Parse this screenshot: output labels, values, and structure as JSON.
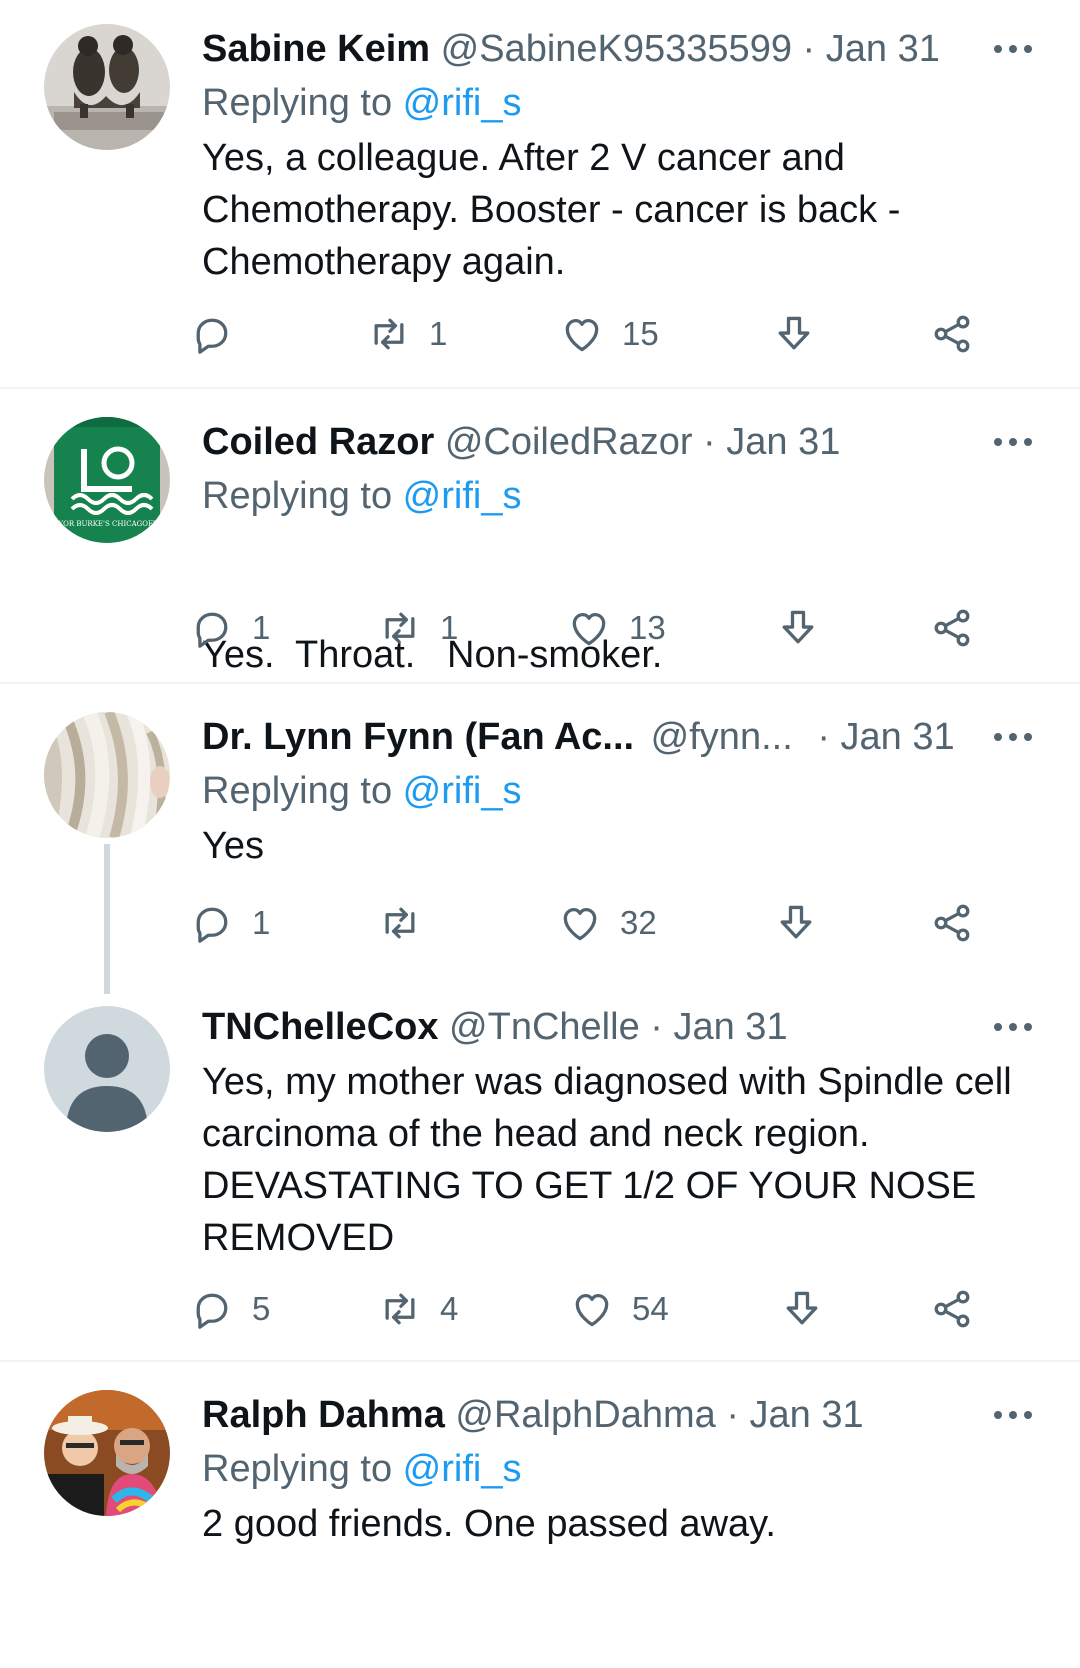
{
  "tweets": [
    {
      "name": "Sabine Keim",
      "handle": "@SabineK95335599",
      "date": "Jan 31",
      "replying_prefix": "Replying to ",
      "replying_to": "@rifi_s",
      "body": [
        "Yes, a colleague. After 2 V cancer and",
        "Chemotherapy. Booster - cancer is back -",
        "Chemotherapy again."
      ],
      "reply_count": "",
      "retweet_count": "1",
      "like_count": "15",
      "avatar_icon": "bronze-statue-avatar"
    },
    {
      "name": "Coiled Razor",
      "handle": "@CoiledRazor",
      "date": "Jan 31",
      "replying_prefix": "Replying to ",
      "replying_to": "@rifi_s",
      "body": [
        "Yes.  Throat.   Non-smoker."
      ],
      "reply_count": "1",
      "retweet_count": "1",
      "like_count": "13",
      "avatar_icon": "green-cup-logo-avatar",
      "avatar_text": "MAYOR BURKE'S CHICAGOFEST"
    },
    {
      "name": "Dr. Lynn Fynn (Fan Ac...",
      "handle": "@fynn...",
      "date": "Jan 31",
      "replying_prefix": "Replying to ",
      "replying_to": "@rifi_s",
      "body": [
        "Yes"
      ],
      "reply_count": "1",
      "retweet_count": "",
      "like_count": "32",
      "avatar_icon": "blonde-hair-avatar"
    },
    {
      "name": "TNChelleCox",
      "handle": "@TnChelle",
      "date": "Jan 31",
      "body": [
        "Yes, my mother was diagnosed with Spindle cell",
        "carcinoma of the head and neck region.",
        "DEVASTATING TO GET 1/2 OF YOUR NOSE",
        "REMOVED"
      ],
      "reply_count": "5",
      "retweet_count": "4",
      "like_count": "54",
      "avatar_icon": "default-profile-avatar"
    },
    {
      "name": "Ralph Dahma",
      "handle": "@RalphDahma",
      "date": "Jan 31",
      "replying_prefix": "Replying to ",
      "replying_to": "@rifi_s",
      "body": [
        "2 good friends. One passed away."
      ],
      "avatar_icon": "couple-photo-avatar"
    }
  ],
  "separator": "·",
  "colors": {
    "text": "#0f1419",
    "secondary": "#536471",
    "link": "#1d9bf0",
    "divider": "#eff3f4"
  }
}
